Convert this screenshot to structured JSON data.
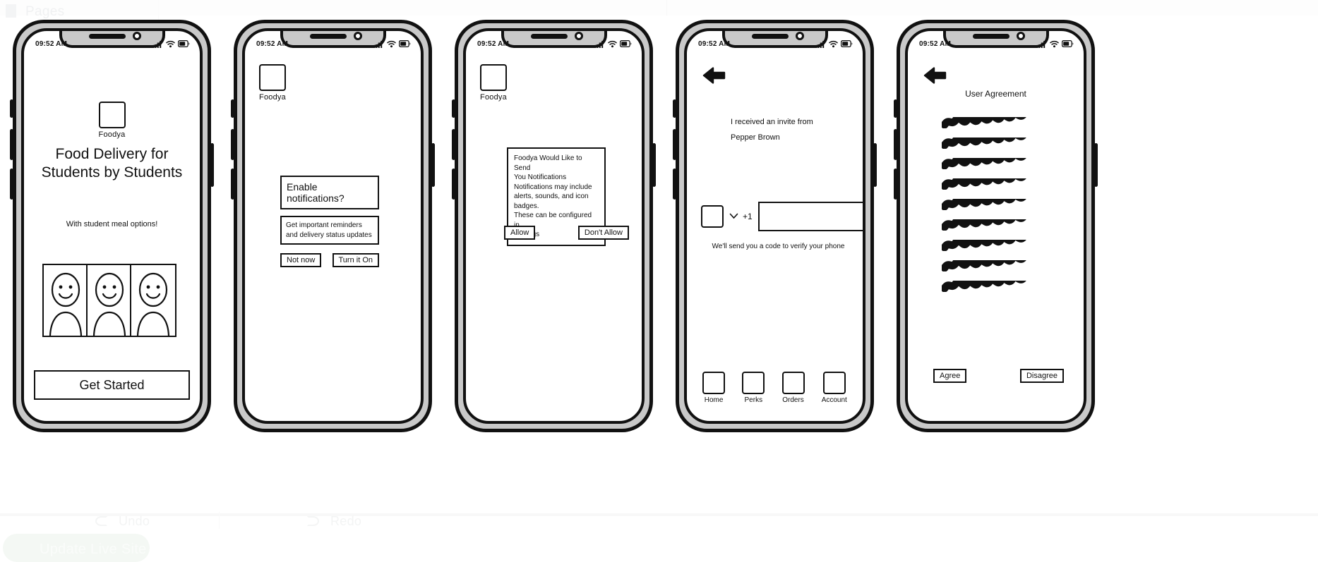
{
  "tool_chrome": {
    "pages_label": "Pages",
    "undo_label": "Undo",
    "redo_label": "Redo",
    "live_site_label": "Update Live Site"
  },
  "status_bar": {
    "time": "09:52 AM",
    "icons": [
      "signal-icon",
      "wifi-icon",
      "battery-icon"
    ]
  },
  "brand": {
    "name": "Foodya"
  },
  "screens": [
    {
      "id": "welcome",
      "logo_label": "Foodya",
      "headline_line1": "Food Delivery for",
      "headline_line2": "Students by Students",
      "subtext": "With student meal options!",
      "cta_label": "Get Started",
      "illustration": "three-students-photo-strip"
    },
    {
      "id": "enable-notifications",
      "logo_label": "Foodya",
      "dialog": {
        "title": "Enable notifications?",
        "body_line1": "Get important reminders",
        "body_line2": "and delivery status updates",
        "secondary_label": "Not now",
        "primary_label": "Turn it On"
      }
    },
    {
      "id": "system-notification-permission",
      "logo_label": "Foodya",
      "dialog": {
        "line1": "Foodya Would Like to Send",
        "line2": "You Notifications",
        "line3": "Notifications may include",
        "line4": "alerts, sounds, and icon",
        "line5": "badges.",
        "line6": "These can be configured in",
        "line7": "Settings",
        "allow_label": "Allow",
        "dont_allow_label": "Don't Allow"
      }
    },
    {
      "id": "phone-verification",
      "back_icon": "arrow-left-icon",
      "invite_line1": "I received an invite from",
      "invite_line2": "Pepper Brown",
      "country_code": "+1",
      "phone_value": "",
      "phone_placeholder": "",
      "hint": "We'll send you a code to verify your phone",
      "tabs": [
        {
          "label": "Home",
          "icon": "home-icon"
        },
        {
          "label": "Perks",
          "icon": "perks-icon"
        },
        {
          "label": "Orders",
          "icon": "orders-icon"
        },
        {
          "label": "Account",
          "icon": "account-icon"
        }
      ]
    },
    {
      "id": "user-agreement",
      "back_icon": "arrow-left-icon",
      "title": "User Agreement",
      "placeholder_lines": 9,
      "agree_label": "Agree",
      "disagree_label": "Disagree"
    }
  ],
  "colors": {
    "stroke": "#111111",
    "frame_inner": "#c9c9c9",
    "screen": "#ffffff",
    "canvas": "#ffffff"
  }
}
